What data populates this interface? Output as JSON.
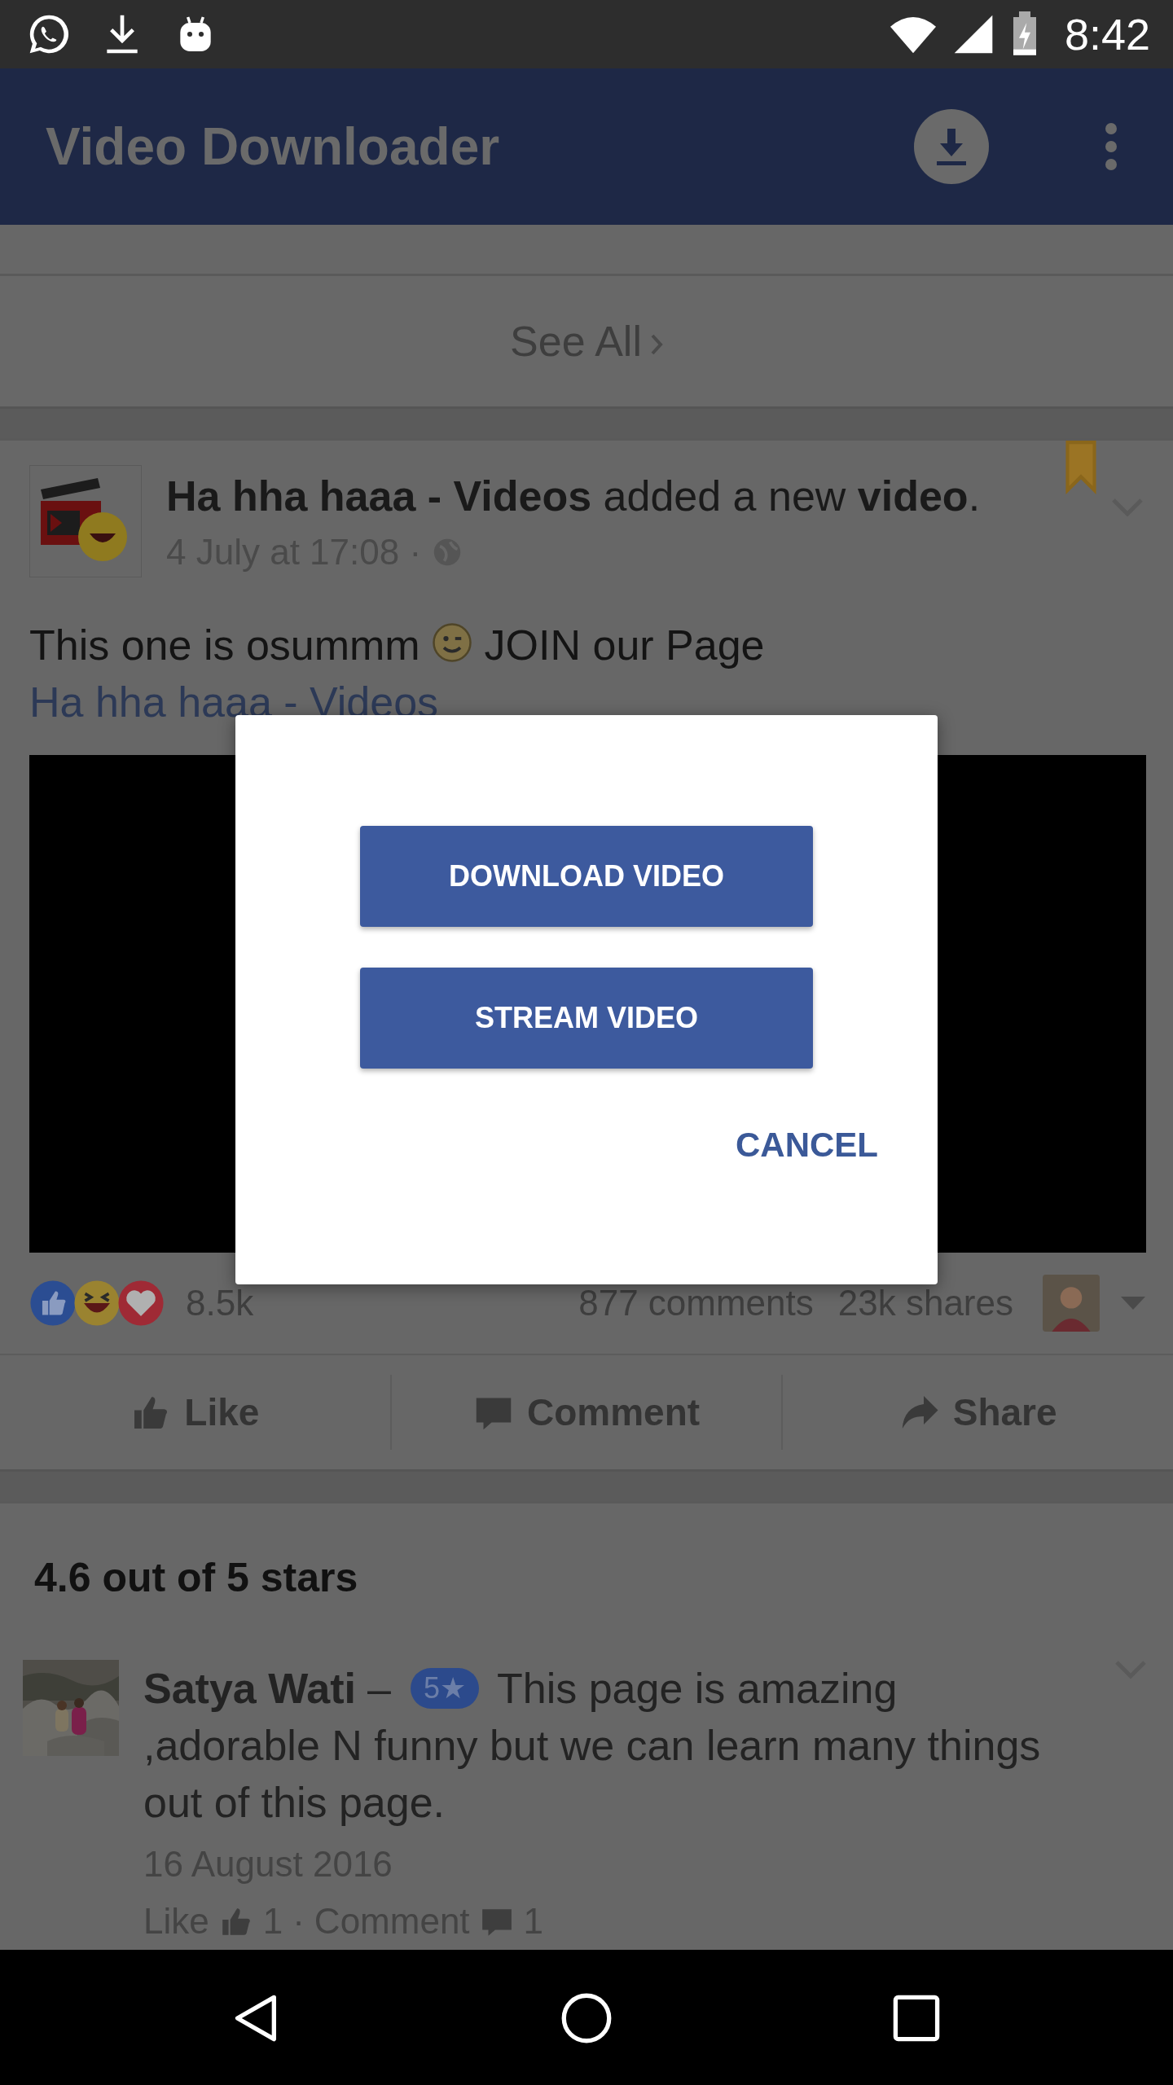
{
  "status_bar": {
    "time": "8:42"
  },
  "app_bar": {
    "title": "Video Downloader"
  },
  "see_all": {
    "label": "See All"
  },
  "post": {
    "headline": "**Ha hha haaa - Videos** added a new **video**.",
    "time": "4 July at 17:08 ·",
    "bookmarked": true,
    "body_before": "This one is osummm",
    "body_after": "JOIN our Page",
    "body_link": "Ha hha haaa - Videos",
    "reactions_count": "8.5k",
    "comments": "877 comments",
    "shares": "23k shares",
    "actions": [
      {
        "kind": "like",
        "label": "Like"
      },
      {
        "kind": "comment",
        "label": "Comment"
      },
      {
        "kind": "share",
        "label": "Share"
      }
    ]
  },
  "rating_summary": "4.6 out of 5 stars",
  "reviews": [
    {
      "name": "Satya Wati",
      "dash": "–",
      "rating": "5★",
      "text_first_line": "This page is amazing",
      "text_rest": ",adorable N funny but we can learn many things out of this page.",
      "date": "16 August 2016",
      "like_label": "Like",
      "like_count": "1",
      "separator": "·",
      "comment_label": "Comment",
      "comment_count": "1"
    }
  ],
  "dialog": {
    "buttons": [
      "DOWNLOAD VIDEO",
      "STREAM VIDEO"
    ],
    "cancel": "CANCEL"
  }
}
